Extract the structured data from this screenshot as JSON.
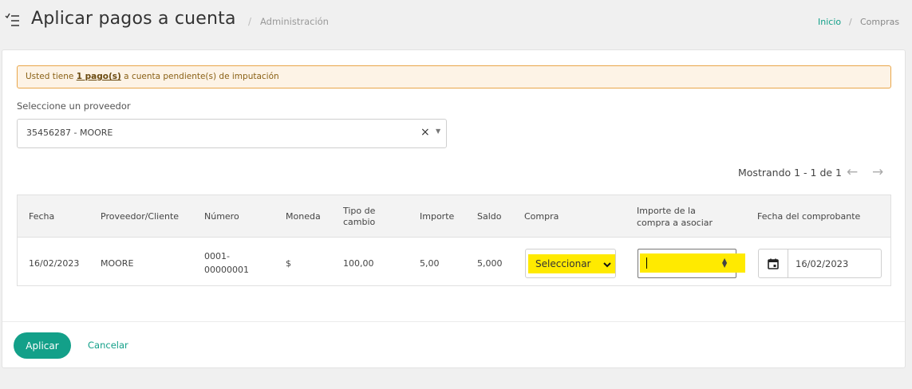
{
  "header": {
    "title": "Aplicar pagos a cuenta",
    "separator": "/",
    "subtitle": "Administración",
    "breadcrumb": {
      "home": "Inicio",
      "separator": "/",
      "current": "Compras"
    }
  },
  "alert": {
    "prefix": "Usted tiene ",
    "link": "1 pago(s)",
    "suffix": " a cuenta pendiente(s) de imputación"
  },
  "provider": {
    "label": "Seleccione un proveedor",
    "value": "35456287 - MOORE",
    "clear": "×",
    "caret": "▼"
  },
  "pager": {
    "text": "Mostrando 1 - 1 de 1",
    "prev": "←",
    "next": "→"
  },
  "table": {
    "headers": {
      "fecha": "Fecha",
      "proveedor": "Proveedor/Cliente",
      "numero": "Número",
      "moneda": "Moneda",
      "tipo_cambio_1": "Tipo de",
      "tipo_cambio_2": "cambio",
      "importe": "Importe",
      "saldo": "Saldo",
      "compra": "Compra",
      "importe_asociar_1": "Importe de la",
      "importe_asociar_2": "compra a asociar",
      "fecha_comprobante": "Fecha del comprobante"
    },
    "row": {
      "fecha": "16/02/2023",
      "proveedor": "MOORE",
      "numero_1": "0001-",
      "numero_2": "00000001",
      "moneda": "$",
      "tipo_cambio": "100,00",
      "importe": "5,00",
      "saldo": "5,000",
      "compra": "Seleccionar",
      "importe_asociar": "",
      "fecha_comprobante": "16/02/2023"
    }
  },
  "actions": {
    "apply": "Aplicar",
    "cancel": "Cancelar"
  },
  "colors": {
    "accent": "#13a089",
    "highlight": "#ffea00",
    "alert_bg": "#fdf3e6",
    "alert_border": "#e9a64a"
  }
}
